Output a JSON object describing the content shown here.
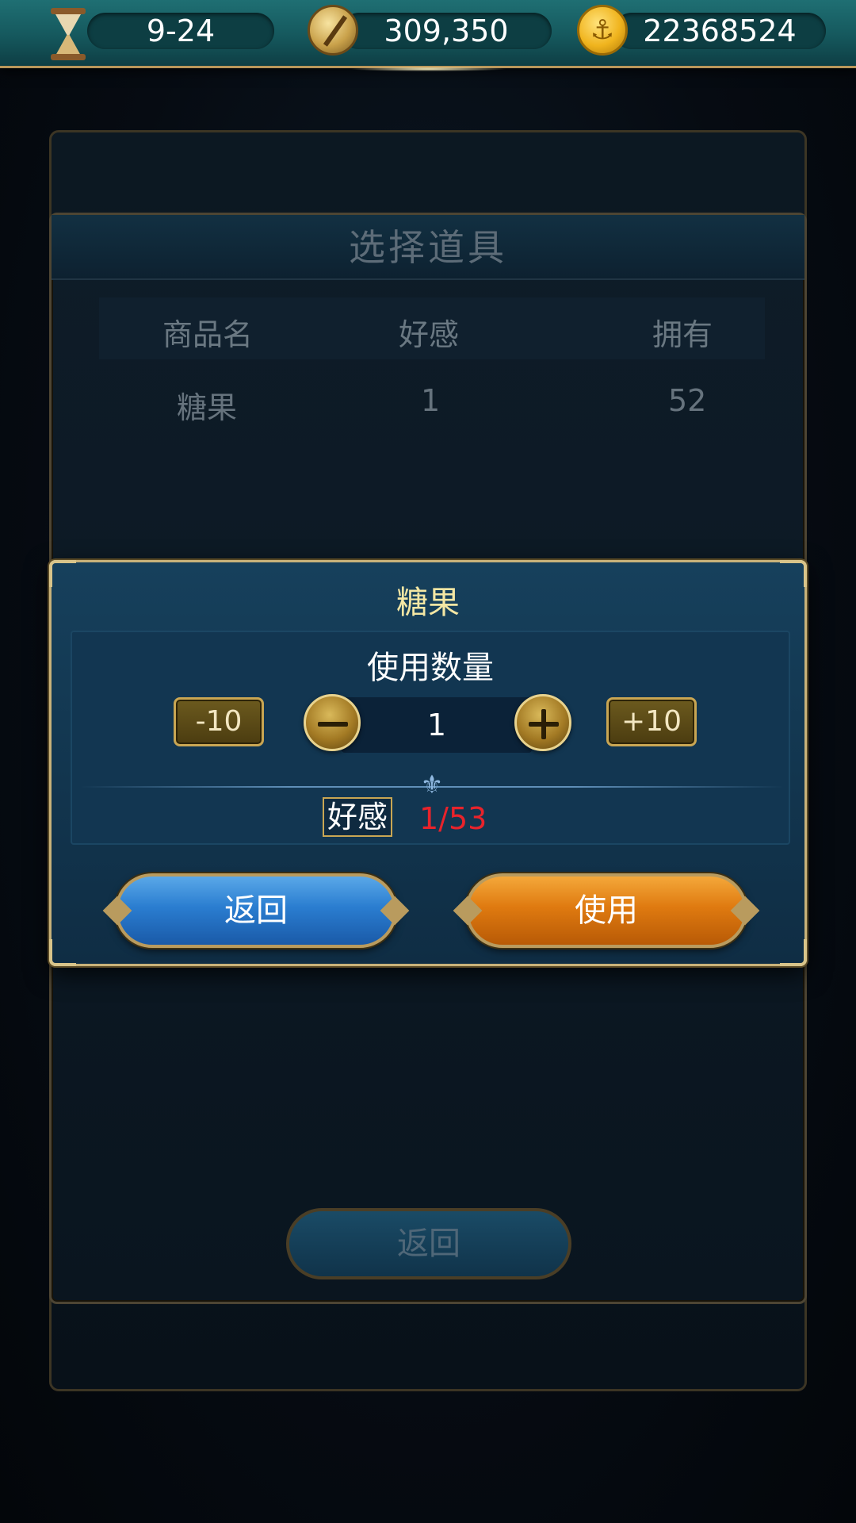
{
  "topbar": {
    "date": "9-24",
    "silver": "309,350",
    "gold": "22368524",
    "icons": [
      "hourglass-icon",
      "compass-icon",
      "anchor-coin-icon"
    ]
  },
  "background_panel": {
    "title": "选择道具",
    "columns": [
      "商品名",
      "好感",
      "拥有"
    ],
    "rows": [
      {
        "name": "糖果",
        "favor": "1",
        "owned": "52"
      }
    ],
    "back_label": "返回"
  },
  "dialog": {
    "title": "糖果",
    "quantity_label": "使用数量",
    "minus10": "-10",
    "plus10": "+10",
    "quantity": "1",
    "favor_label": "好感",
    "favor_value": "1/53",
    "back_label": "返回",
    "use_label": "使用"
  },
  "colors": {
    "accent_gold": "#c9a653",
    "title_yellow": "#f4e7a4",
    "favor_red": "#e8232b",
    "back_blue": "#2a7dd0",
    "use_orange": "#df7a10"
  }
}
